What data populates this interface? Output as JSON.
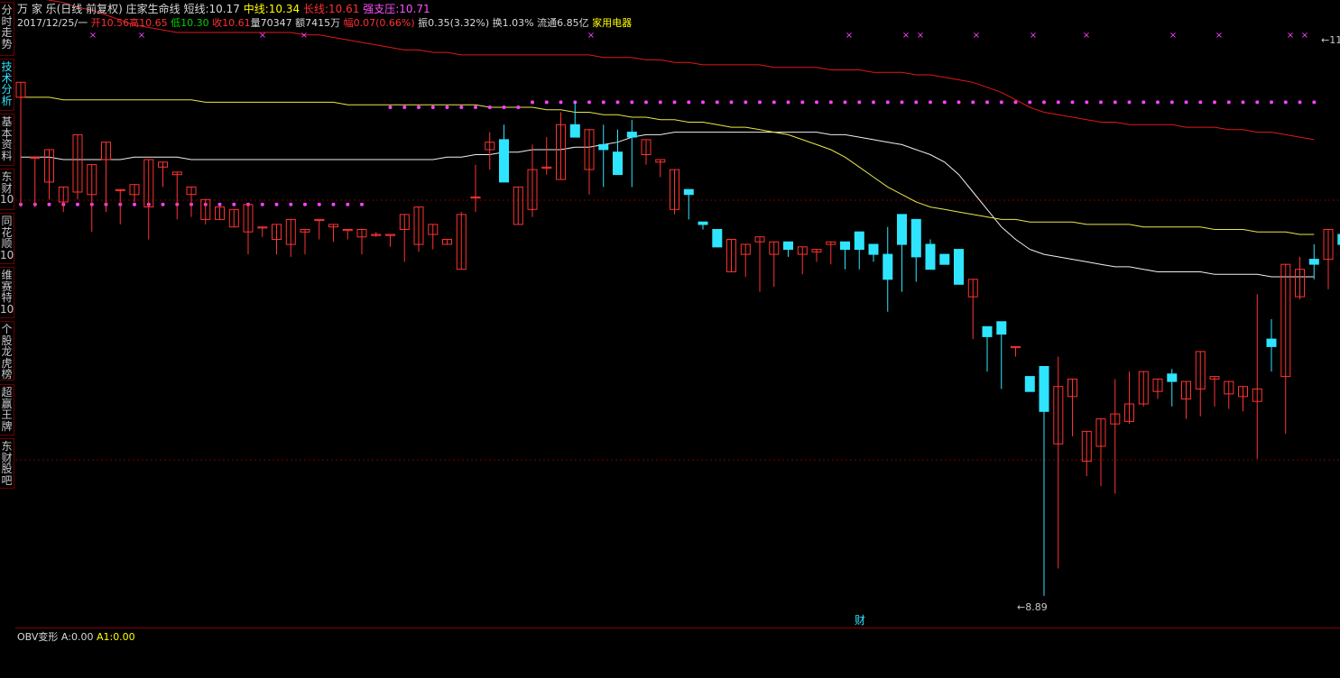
{
  "sidebar": {
    "tabs": [
      {
        "label": "分时走势",
        "active": false
      },
      {
        "label": "技术分析",
        "active": true
      },
      {
        "label": "基本资料",
        "active": false
      },
      {
        "label": "东财10",
        "active": false
      },
      {
        "label": "同花顺10",
        "active": false
      },
      {
        "label": "维赛特10",
        "active": false
      },
      {
        "label": "个股龙虎榜",
        "active": false
      },
      {
        "label": "超赢王牌",
        "active": false
      },
      {
        "label": "东财股吧",
        "active": false
      }
    ]
  },
  "header": {
    "stock_name": "万 家 乐(日线 前复权)",
    "indicator_name": "庄家生命线",
    "short_label": "短线:",
    "short_value": "10.17",
    "mid_label": "中线:",
    "mid_value": "10.34",
    "long_label": "长线:",
    "long_value": "10.61",
    "support_label": "强支压:",
    "support_value": "10.71"
  },
  "quote": {
    "date": "2017/12/25/一",
    "open_label": "开",
    "open": "10.56",
    "high_label": "高",
    "high": "10.65",
    "low_label": "低",
    "low": "10.30",
    "close_label": "收",
    "close": "10.61",
    "volume_label": "量",
    "volume": "70347",
    "amount_label": "额",
    "amount": "7415万",
    "change_label": "幅",
    "change": "0.07(0.66%)",
    "amplitude_label": "振",
    "amplitude": "0.35(3.32%)",
    "turnover_label": "换",
    "turnover": "1.03%",
    "float_label": "流通",
    "float_cap": "6.85亿",
    "sector": "家用电器"
  },
  "annotations": {
    "low_marker": "8.89",
    "finance_marker": "财",
    "high_marker": "11"
  },
  "obv": {
    "title": "OBV变形",
    "a_label": "A:",
    "a_value": "0.00",
    "a1_label": "A1:",
    "a1_value": "0.00"
  },
  "colors": {
    "up": "#ff3232",
    "down": "#2fe4ff",
    "short_line": "#f0f0f0",
    "mid_line": "#e8e84a",
    "long_line": "#e01818",
    "dots": "#ff40ff"
  },
  "chart_data": {
    "type": "candlestick",
    "y_range": [
      8.85,
      11.15
    ],
    "candles": [
      [
        10.89,
        10.95,
        10.25,
        10.45
      ],
      [
        10.65,
        10.65,
        10.5,
        10.45
      ],
      [
        10.55,
        10.68,
        10.42,
        10.48
      ],
      [
        10.47,
        10.53,
        10.34,
        10.43
      ],
      [
        10.51,
        10.74,
        10.32,
        10.48
      ],
      [
        10.5,
        10.62,
        10.49,
        10.35
      ],
      [
        10.64,
        10.71,
        10.52,
        10.43
      ],
      [
        10.52,
        10.52,
        10.48,
        10.38
      ],
      [
        10.5,
        10.54,
        10.48,
        10.47
      ],
      [
        10.45,
        10.64,
        10.45,
        10.32
      ],
      [
        10.61,
        10.63,
        10.6,
        10.53
      ],
      [
        10.58,
        10.59,
        10.44,
        10.4
      ],
      [
        10.5,
        10.53,
        10.48,
        10.41
      ],
      [
        10.4,
        10.48,
        10.37,
        10.38
      ],
      [
        10.4,
        10.45,
        10.39,
        10.4
      ],
      [
        10.37,
        10.44,
        10.4,
        10.42
      ],
      [
        10.35,
        10.46,
        10.38,
        10.26
      ],
      [
        10.37,
        10.37,
        10.33,
        10.33
      ],
      [
        10.32,
        10.38,
        10.28,
        10.26
      ],
      [
        10.3,
        10.4,
        10.33,
        10.25
      ],
      [
        10.35,
        10.36,
        10.31,
        10.26
      ],
      [
        10.4,
        10.4,
        10.33,
        10.32
      ],
      [
        10.37,
        10.38,
        10.33,
        10.31
      ],
      [
        10.36,
        10.36,
        10.33,
        10.32
      ],
      [
        10.33,
        10.36,
        10.35,
        10.26
      ],
      [
        10.34,
        10.34,
        10.35,
        10.33
      ],
      [
        10.34,
        10.34,
        10.32,
        10.29
      ],
      [
        10.36,
        10.42,
        10.3,
        10.23
      ],
      [
        10.3,
        10.45,
        10.37,
        10.27
      ],
      [
        10.34,
        10.38,
        10.35,
        10.28
      ],
      [
        10.3,
        10.32,
        10.3,
        10.3
      ],
      [
        10.2,
        10.42,
        10.43,
        10.29
      ],
      [
        10.49,
        10.49,
        10.62,
        10.43
      ],
      [
        10.68,
        10.71,
        10.75,
        10.6
      ],
      [
        10.72,
        10.55,
        10.78,
        10.58
      ],
      [
        10.38,
        10.53,
        10.46,
        10.41
      ],
      [
        10.44,
        10.6,
        10.7,
        10.41
      ],
      [
        10.61,
        10.61,
        10.73,
        10.58
      ],
      [
        10.56,
        10.78,
        10.83,
        10.64
      ],
      [
        10.78,
        10.73,
        10.87,
        10.8
      ],
      [
        10.6,
        10.76,
        10.6,
        10.5
      ],
      [
        10.7,
        10.68,
        10.78,
        10.53
      ],
      [
        10.67,
        10.58,
        10.76,
        10.58
      ],
      [
        10.75,
        10.73,
        10.8,
        10.53
      ],
      [
        10.66,
        10.72,
        10.67,
        10.62
      ],
      [
        10.63,
        10.64,
        10.56,
        10.57
      ],
      [
        10.44,
        10.6,
        10.57,
        10.42
      ],
      [
        10.52,
        10.5,
        10.4,
        10.4
      ],
      [
        10.39,
        10.38,
        10.36,
        10.36
      ],
      [
        10.36,
        10.29,
        10.33,
        10.33
      ],
      [
        10.19,
        10.32,
        10.28,
        10.28
      ],
      [
        10.26,
        10.3,
        10.22,
        10.17
      ],
      [
        10.31,
        10.33,
        10.27,
        10.11
      ],
      [
        10.26,
        10.31,
        10.25,
        10.13
      ],
      [
        10.31,
        10.28,
        10.29,
        10.25
      ],
      [
        10.26,
        10.29,
        10.23,
        10.18
      ],
      [
        10.27,
        10.28,
        10.23,
        10.23
      ],
      [
        10.3,
        10.31,
        10.24,
        10.22
      ],
      [
        10.31,
        10.28,
        10.2,
        10.2
      ],
      [
        10.35,
        10.28,
        10.2,
        10.2
      ],
      [
        10.3,
        10.26,
        10.25,
        10.23
      ],
      [
        10.26,
        10.16,
        10.37,
        10.03
      ],
      [
        10.42,
        10.3,
        10.39,
        10.11
      ],
      [
        10.4,
        10.25,
        10.33,
        10.15
      ],
      [
        10.3,
        10.2,
        10.32,
        10.24
      ],
      [
        10.26,
        10.22,
        10.26,
        10.24
      ],
      [
        10.28,
        10.14,
        10.14,
        10.14
      ],
      [
        10.09,
        10.16,
        9.88,
        9.92
      ],
      [
        9.97,
        9.93,
        9.76,
        9.79
      ],
      [
        9.99,
        9.94,
        9.91,
        9.72
      ],
      [
        9.89,
        9.89,
        9.88,
        9.85
      ],
      [
        9.77,
        9.71,
        9.71,
        9.71
      ],
      [
        9.81,
        9.63,
        9.65,
        8.89
      ],
      [
        9.5,
        9.73,
        9.85,
        9.0
      ],
      [
        9.69,
        9.76,
        9.69,
        9.53
      ],
      [
        9.43,
        9.55,
        9.48,
        9.37
      ],
      [
        9.49,
        9.6,
        9.51,
        9.33
      ],
      [
        9.58,
        9.62,
        9.76,
        9.3
      ],
      [
        9.59,
        9.66,
        9.79,
        9.58
      ],
      [
        9.66,
        9.79,
        9.72,
        9.65
      ],
      [
        9.71,
        9.76,
        9.76,
        9.68
      ],
      [
        9.78,
        9.75,
        9.8,
        9.65
      ],
      [
        9.68,
        9.75,
        9.75,
        9.6
      ],
      [
        9.72,
        9.87,
        9.7,
        9.61
      ],
      [
        9.76,
        9.77,
        9.77,
        9.65
      ],
      [
        9.7,
        9.75,
        9.67,
        9.64
      ],
      [
        9.69,
        9.73,
        9.73,
        9.63
      ],
      [
        9.67,
        9.72,
        10.1,
        9.44
      ],
      [
        9.92,
        9.89,
        10.0,
        9.79
      ],
      [
        9.77,
        10.22,
        10.0,
        9.54
      ],
      [
        10.09,
        10.2,
        10.25,
        10.08
      ],
      [
        10.24,
        10.22,
        10.3,
        10.16
      ],
      [
        10.24,
        10.36,
        10.36,
        10.12
      ],
      [
        10.34,
        10.3,
        10.38,
        10.17
      ],
      [
        10.25,
        10.88,
        10.75,
        10.3
      ],
      [
        10.82,
        10.77,
        10.88,
        10.73
      ]
    ],
    "series": [
      {
        "name": "短线",
        "values": [
          10.65,
          10.65,
          10.65,
          10.64,
          10.64,
          10.64,
          10.64,
          10.64,
          10.65,
          10.65,
          10.65,
          10.65,
          10.64,
          10.64,
          10.64,
          10.64,
          10.64,
          10.64,
          10.64,
          10.64,
          10.64,
          10.64,
          10.64,
          10.64,
          10.64,
          10.64,
          10.64,
          10.64,
          10.64,
          10.64,
          10.65,
          10.65,
          10.66,
          10.66,
          10.67,
          10.67,
          10.68,
          10.68,
          10.68,
          10.69,
          10.69,
          10.7,
          10.71,
          10.73,
          10.74,
          10.74,
          10.75,
          10.75,
          10.75,
          10.75,
          10.75,
          10.75,
          10.75,
          10.75,
          10.75,
          10.75,
          10.75,
          10.74,
          10.74,
          10.73,
          10.72,
          10.71,
          10.7,
          10.68,
          10.66,
          10.63,
          10.58,
          10.51,
          10.44,
          10.37,
          10.32,
          10.28,
          10.26,
          10.25,
          10.24,
          10.23,
          10.22,
          10.21,
          10.21,
          10.2,
          10.19,
          10.19,
          10.19,
          10.19,
          10.18,
          10.18,
          10.18,
          10.18,
          10.17,
          10.17,
          10.17,
          10.17
        ]
      },
      {
        "name": "中线",
        "values": [
          10.89,
          10.89,
          10.89,
          10.88,
          10.88,
          10.88,
          10.88,
          10.88,
          10.88,
          10.88,
          10.88,
          10.88,
          10.88,
          10.87,
          10.87,
          10.87,
          10.87,
          10.87,
          10.87,
          10.87,
          10.87,
          10.87,
          10.87,
          10.86,
          10.86,
          10.86,
          10.86,
          10.86,
          10.86,
          10.86,
          10.86,
          10.86,
          10.86,
          10.85,
          10.85,
          10.85,
          10.85,
          10.84,
          10.84,
          10.83,
          10.83,
          10.82,
          10.82,
          10.81,
          10.81,
          10.8,
          10.8,
          10.79,
          10.79,
          10.78,
          10.77,
          10.77,
          10.76,
          10.75,
          10.74,
          10.72,
          10.7,
          10.68,
          10.65,
          10.61,
          10.57,
          10.53,
          10.5,
          10.47,
          10.45,
          10.44,
          10.43,
          10.42,
          10.41,
          10.4,
          10.4,
          10.39,
          10.39,
          10.39,
          10.39,
          10.38,
          10.38,
          10.38,
          10.38,
          10.37,
          10.37,
          10.37,
          10.37,
          10.37,
          10.36,
          10.36,
          10.36,
          10.35,
          10.35,
          10.35,
          10.34,
          10.34
        ]
      },
      {
        "name": "长线",
        "values": [
          11.3,
          11.29,
          11.28,
          11.27,
          11.25,
          11.24,
          11.22,
          11.2,
          11.18,
          11.17,
          11.16,
          11.15,
          11.15,
          11.15,
          11.15,
          11.15,
          11.15,
          11.15,
          11.15,
          11.15,
          11.14,
          11.14,
          11.13,
          11.12,
          11.11,
          11.1,
          11.09,
          11.08,
          11.08,
          11.07,
          11.07,
          11.06,
          11.06,
          11.06,
          11.06,
          11.06,
          11.06,
          11.06,
          11.06,
          11.06,
          11.06,
          11.05,
          11.05,
          11.05,
          11.04,
          11.04,
          11.03,
          11.03,
          11.02,
          11.02,
          11.02,
          11.02,
          11.02,
          11.01,
          11.01,
          11.01,
          11.01,
          11.0,
          11.0,
          11.0,
          10.99,
          10.99,
          10.99,
          10.98,
          10.98,
          10.97,
          10.96,
          10.95,
          10.93,
          10.91,
          10.88,
          10.85,
          10.83,
          10.82,
          10.81,
          10.8,
          10.79,
          10.79,
          10.78,
          10.78,
          10.78,
          10.78,
          10.77,
          10.77,
          10.77,
          10.76,
          10.76,
          10.75,
          10.75,
          10.74,
          10.73,
          10.72
        ]
      },
      {
        "name": "强支压",
        "values": [
          10.46,
          10.46,
          10.46,
          10.46,
          10.46,
          10.46,
          10.46,
          10.46,
          10.46,
          10.46,
          10.46,
          10.46,
          10.46,
          10.46,
          10.46,
          10.46,
          10.46,
          10.46,
          10.46,
          10.46,
          10.46,
          10.46,
          10.46,
          10.46,
          10.46,
          10.85,
          10.85,
          10.85,
          10.85,
          10.85,
          10.85,
          10.85,
          10.85,
          10.85,
          10.85,
          10.85,
          10.87,
          10.87,
          10.87,
          10.87,
          10.87,
          10.87,
          10.87,
          10.87,
          10.87,
          10.87,
          10.87,
          10.87,
          10.87,
          10.87,
          10.87,
          10.87,
          10.87,
          10.87,
          10.87,
          10.87,
          10.87,
          10.87,
          10.87,
          10.87,
          10.87,
          10.87,
          10.87,
          10.87,
          10.87,
          10.87,
          10.87,
          10.87,
          10.87,
          10.87,
          10.87,
          10.87,
          10.87,
          10.87,
          10.87,
          10.87,
          10.87,
          10.87,
          10.87,
          10.87,
          10.87,
          10.87,
          10.87,
          10.87,
          10.87,
          10.87,
          10.87,
          10.87,
          10.87,
          10.87,
          10.87,
          10.87
        ]
      }
    ]
  }
}
